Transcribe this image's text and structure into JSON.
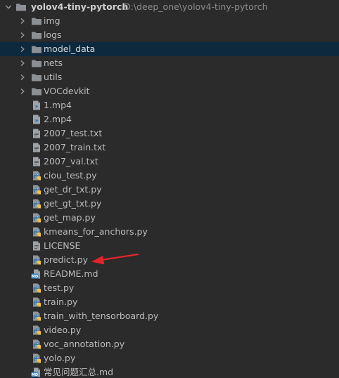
{
  "project": {
    "name": "yolov4-tiny-pytorch",
    "path": "D:\\deep_one\\yolov4-tiny-pytorch"
  },
  "folders": [
    {
      "label": "img"
    },
    {
      "label": "logs"
    },
    {
      "label": "model_data"
    },
    {
      "label": "nets"
    },
    {
      "label": "utils"
    },
    {
      "label": "VOCdevkit"
    }
  ],
  "files": [
    {
      "label": "1.mp4",
      "icon": "video-file-icon"
    },
    {
      "label": "2.mp4",
      "icon": "video-file-icon"
    },
    {
      "label": "2007_test.txt",
      "icon": "text-file-icon"
    },
    {
      "label": "2007_train.txt",
      "icon": "text-file-icon"
    },
    {
      "label": "2007_val.txt",
      "icon": "text-file-icon"
    },
    {
      "label": "ciou_test.py",
      "icon": "python-file-icon"
    },
    {
      "label": "get_dr_txt.py",
      "icon": "python-file-icon"
    },
    {
      "label": "get_gt_txt.py",
      "icon": "python-file-icon"
    },
    {
      "label": "get_map.py",
      "icon": "python-file-icon"
    },
    {
      "label": "kmeans_for_anchors.py",
      "icon": "python-file-icon"
    },
    {
      "label": "LICENSE",
      "icon": "text-file-icon"
    },
    {
      "label": "predict.py",
      "icon": "python-file-icon"
    },
    {
      "label": "README.md",
      "icon": "markdown-file-icon"
    },
    {
      "label": "test.py",
      "icon": "python-file-icon"
    },
    {
      "label": "train.py",
      "icon": "python-file-icon"
    },
    {
      "label": "train_with_tensorboard.py",
      "icon": "python-file-icon"
    },
    {
      "label": "video.py",
      "icon": "python-file-icon"
    },
    {
      "label": "voc_annotation.py",
      "icon": "python-file-icon"
    },
    {
      "label": "yolo.py",
      "icon": "python-file-icon"
    },
    {
      "label": "常见问题汇总.md",
      "icon": "markdown-file-icon"
    }
  ],
  "selected_item": "model_data",
  "highlighted_file": "predict.py",
  "colors": {
    "background": "#2b2b2b",
    "selection": "#0d293e",
    "text": "#bbbbbb",
    "path_text": "#8c8c8c",
    "folder": "#8c8f94",
    "annotation_arrow": "#e0252a"
  }
}
